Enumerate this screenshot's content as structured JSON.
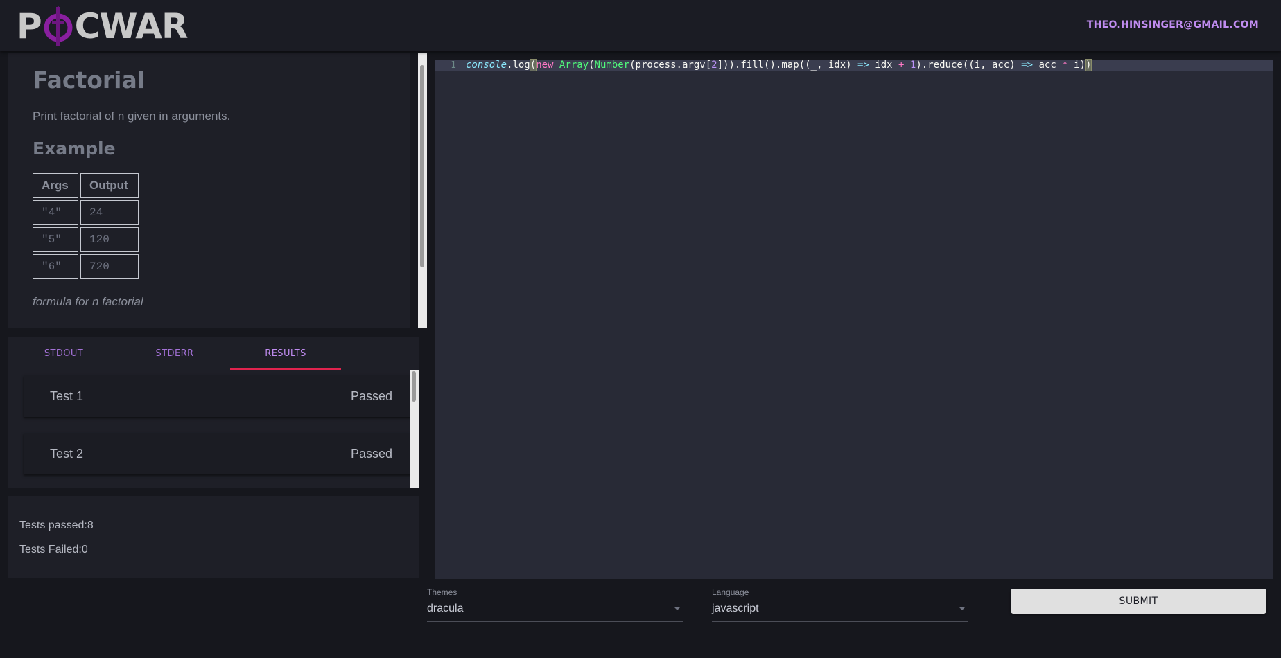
{
  "header": {
    "logo_text_left": "P",
    "logo_text_right": "CWAR",
    "user_email": "THEO.HINSINGER@GMAIL.COM"
  },
  "problem": {
    "title": "Factorial",
    "description": "Print factorial of n given in arguments.",
    "example_title": "Example",
    "table_headers": [
      "Args",
      "Output"
    ],
    "table_rows": [
      {
        "args": "\"4\"",
        "output": "24"
      },
      {
        "args": "\"5\"",
        "output": "120"
      },
      {
        "args": "\"6\"",
        "output": "720"
      }
    ],
    "note": "formula for n factorial"
  },
  "output": {
    "tabs": [
      {
        "label": "STDOUT",
        "active": false
      },
      {
        "label": "STDERR",
        "active": false
      },
      {
        "label": "RESULTS",
        "active": true
      }
    ],
    "results": [
      {
        "name": "Test 1",
        "status": "Passed"
      },
      {
        "name": "Test 2",
        "status": "Passed"
      }
    ]
  },
  "summary": {
    "passed": "Tests passed:8",
    "failed": "Tests Failed:0"
  },
  "editor": {
    "line_number": "1",
    "code": "console.log(new Array(Number(process.argv[2])).fill().map((_, idx) => idx + 1).reduce((i, acc) => acc * i))",
    "theme_colors": {
      "background": "#282a36",
      "keyword": "#ff79c6",
      "class": "#50fa7b",
      "number": "#bd93f9",
      "builtin": "#8be9fd"
    }
  },
  "controls": {
    "themes_label": "Themes",
    "themes_value": "dracula",
    "language_label": "Language",
    "language_value": "javascript",
    "submit_label": "SUBMIT"
  },
  "colors": {
    "accent": "#c08cf0",
    "tab_indicator": "#e0234e",
    "background": "#16171d",
    "panel": "#1e1f27"
  }
}
